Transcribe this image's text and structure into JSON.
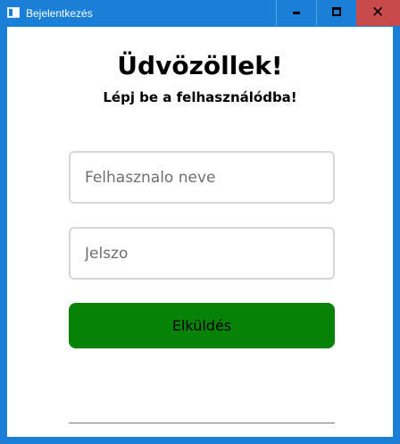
{
  "window": {
    "title": "Bejelentkezés",
    "controls": {
      "minimize": "minimize-icon",
      "maximize": "maximize-icon",
      "close": "close-icon"
    }
  },
  "login": {
    "heading": "Üdvözöllek!",
    "subheading": "Lépj be a felhasználódba!",
    "username_placeholder": "Felhasznalo neve",
    "password_placeholder": "Jelszo",
    "submit_label": "Elküldés"
  },
  "colors": {
    "titlebar": "#1a7fd6",
    "close_button": "#c94a4a",
    "submit_button": "#068206"
  }
}
